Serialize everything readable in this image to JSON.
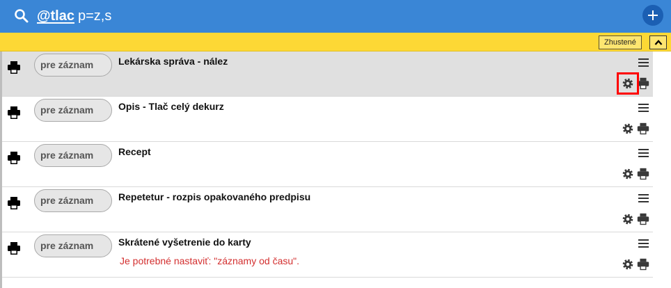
{
  "header": {
    "command": "@tlac",
    "arguments": "p=z,s",
    "search_icon": "search-icon",
    "add_icon": "plus-icon"
  },
  "toolbar": {
    "compact_label": "Zhustené",
    "collapse_icon": "chevron-up-icon"
  },
  "rows": [
    {
      "pill": "pre záznam",
      "title": "Lekárska správa - nález",
      "warning": "",
      "selected": true
    },
    {
      "pill": "pre záznam",
      "title": "Opis - Tlač celý dekurz",
      "warning": "",
      "selected": false
    },
    {
      "pill": "pre záznam",
      "title": "Recept",
      "warning": "",
      "selected": false
    },
    {
      "pill": "pre záznam",
      "title": "Repetetur - rozpis opakovaného predpisu",
      "warning": "",
      "selected": false
    },
    {
      "pill": "pre záznam",
      "title": "Skrátené vyšetrenie do karty",
      "warning": "Je potrebné nastaviť: \"záznamy od času\".",
      "selected": false
    }
  ],
  "colors": {
    "header_bg": "#3a86d6",
    "add_button": "#1b5fb3",
    "toolbar_bg": "#fdd835",
    "warning_text": "#d32f2f",
    "highlight": "#ff0000"
  }
}
